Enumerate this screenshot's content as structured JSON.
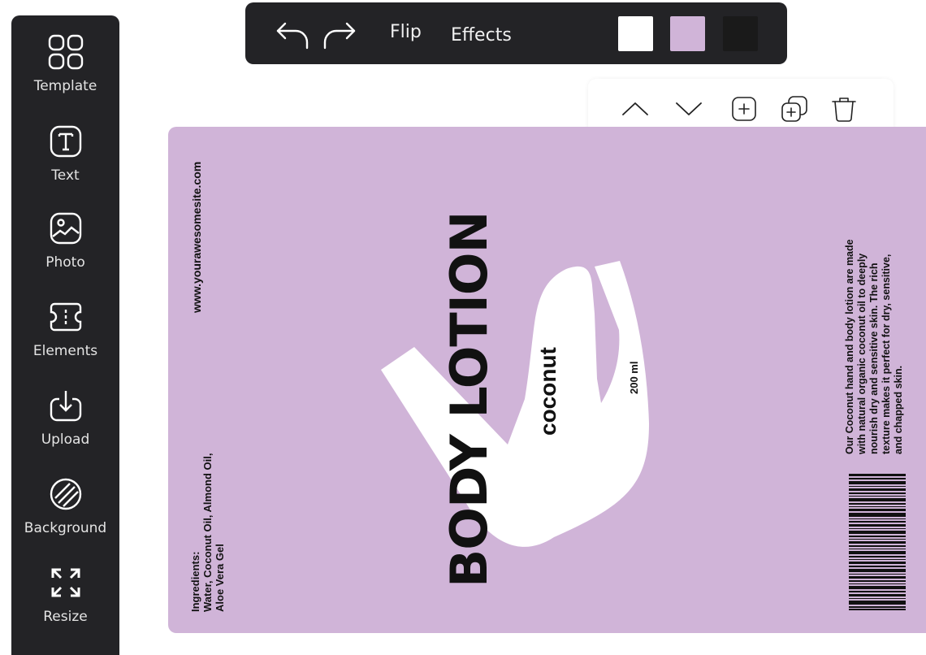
{
  "sidebar": {
    "items": [
      {
        "label": "Template",
        "icon": "template-icon"
      },
      {
        "label": "Text",
        "icon": "text-icon"
      },
      {
        "label": "Photo",
        "icon": "photo-icon"
      },
      {
        "label": "Elements",
        "icon": "elements-icon"
      },
      {
        "label": "Upload",
        "icon": "upload-icon"
      },
      {
        "label": "Background",
        "icon": "background-icon"
      },
      {
        "label": "Resize",
        "icon": "resize-icon"
      }
    ]
  },
  "toolbar": {
    "undo_icon": "undo-icon",
    "redo_icon": "redo-icon",
    "flip_label": "Flip",
    "effects_label": "Effects",
    "swatches": [
      {
        "name": "white",
        "color": "#ffffff"
      },
      {
        "name": "lavender",
        "color": "#d0b4d8"
      },
      {
        "name": "black",
        "color": "#1a1a1a"
      }
    ]
  },
  "element_tools": {
    "icons": [
      "move-up-icon",
      "move-down-icon",
      "add-icon",
      "duplicate-icon",
      "delete-icon"
    ]
  },
  "label": {
    "background_color": "#d0b4d8",
    "website": "www.yourawesomesite.com",
    "ingredients_title": "Ingredients:",
    "ingredients_line1": "Water, Coconut Oil, Almond Oil,",
    "ingredients_line2": "Aloe Vera Gel",
    "title": "BODY LOTION",
    "subtitle": "coconut",
    "volume": "200 ml",
    "description_lines": [
      "Our Coconut hand and body lotion are made",
      "with natural organic coconut oil to deeply",
      "nourish dry and sensitive skin. The rich",
      "texture makes it perfect for dry, sensitive,",
      "and chapped skin."
    ]
  }
}
